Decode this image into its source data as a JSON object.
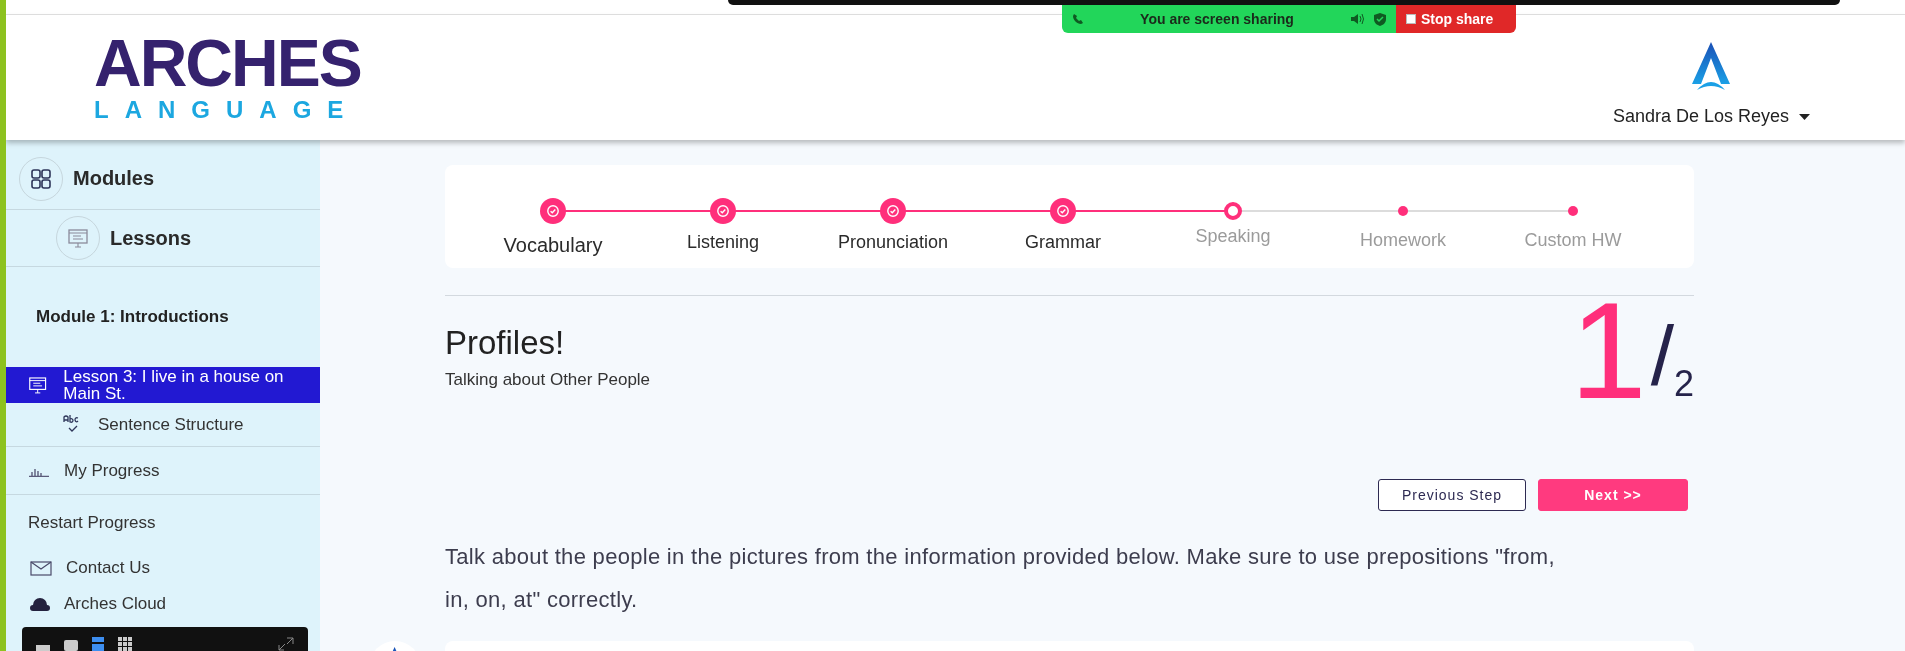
{
  "screen_share": {
    "message": "You are screen sharing",
    "stop_label": "Stop share"
  },
  "header": {
    "logo_top": "ARCHES",
    "logo_bottom": "LANGUAGE",
    "user_name": "Sandra De Los Reyes"
  },
  "sidebar": {
    "modules": "Modules",
    "lessons": "Lessons",
    "module_title": "Module 1: Introductions",
    "lesson_items": [
      {
        "kind": "lesson",
        "label": "Lesson 3: I live in a house on Main St.",
        "selected": true
      },
      {
        "kind": "topic",
        "label": "Sentence Structure",
        "selected": false
      }
    ],
    "my_progress": "My Progress",
    "restart": "Restart Progress",
    "contact": "Contact Us",
    "cloud": "Arches Cloud"
  },
  "steps": [
    {
      "label": "Vocabulary",
      "completed": true,
      "current": false,
      "selected": true
    },
    {
      "label": "Listening",
      "completed": true,
      "current": false,
      "selected": false
    },
    {
      "label": "Pronunciation",
      "completed": true,
      "current": false,
      "selected": false
    },
    {
      "label": "Grammar",
      "completed": true,
      "current": false,
      "selected": false
    },
    {
      "label": "Speaking",
      "completed": false,
      "current": true,
      "selected": false
    },
    {
      "label": "Homework",
      "completed": false,
      "current": false,
      "selected": false
    },
    {
      "label": "Custom HW",
      "completed": false,
      "current": false,
      "selected": false
    }
  ],
  "activity": {
    "title": "Profiles!",
    "subtitle": "Talking about Other People",
    "counter_current": "1",
    "counter_separator": "/",
    "counter_total": "2"
  },
  "buttons": {
    "previous": "Previous Step",
    "next": "Next >>"
  },
  "instructions": "Talk about the people in the pictures from the information provided below. Make sure to use prepositions \"from, in, on, at\" correctly."
}
